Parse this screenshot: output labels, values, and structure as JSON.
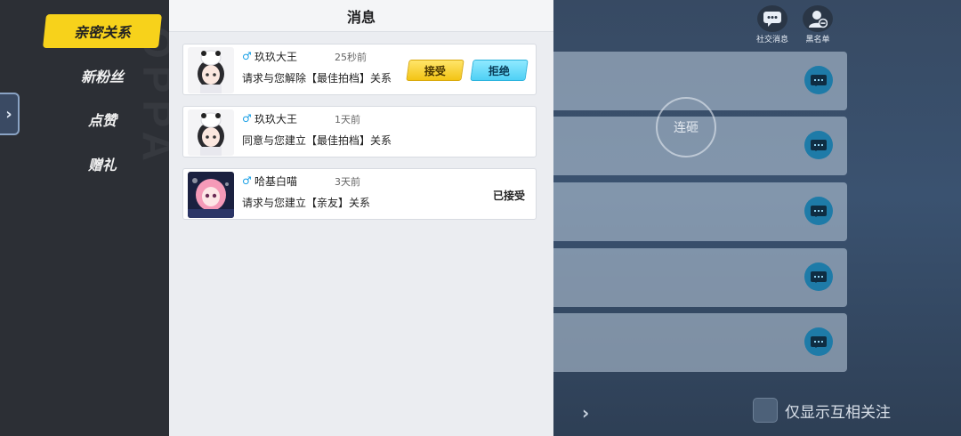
{
  "panel": {
    "title": "消息"
  },
  "sidebar": {
    "items": [
      {
        "label": "亲密关系",
        "active": true
      },
      {
        "label": "新粉丝",
        "active": false
      },
      {
        "label": "点赞",
        "active": false
      },
      {
        "label": "赠礼",
        "active": false
      }
    ],
    "collapse_icon": "chevron-right-icon"
  },
  "messages": [
    {
      "gender_icon": "male-icon",
      "gender_glyph": "♂",
      "username": "玖玖大王",
      "time": "25秒前",
      "text": "请求与您解除【最佳拍档】关系",
      "actions": {
        "accept": "接受",
        "reject": "拒绝"
      }
    },
    {
      "gender_icon": "male-icon",
      "gender_glyph": "♂",
      "username": "玖玖大王",
      "time": "1天前",
      "text": "同意与您建立【最佳拍档】关系"
    },
    {
      "gender_icon": "male-icon",
      "gender_glyph": "♂",
      "username": "哈基白喵",
      "time": "3天前",
      "text": "请求与您建立【亲友】关系",
      "status": "已接受"
    }
  ],
  "top_right": {
    "social_label": "社交消息",
    "blacklist_label": "黑名单"
  },
  "background": {
    "circle_label": "连砸",
    "mutual_label": "仅显示互相关注"
  },
  "colors": {
    "active_tab": "#f7d21b",
    "accept": "#f3c414",
    "reject": "#4fd0f5",
    "gender": "#1aa0e6"
  }
}
